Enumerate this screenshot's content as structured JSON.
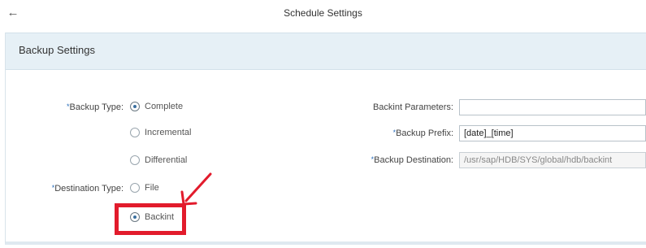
{
  "header": {
    "title": "Schedule Settings",
    "back_icon": "arrow-left-icon"
  },
  "panel": {
    "title": "Backup Settings"
  },
  "backup_type": {
    "label": "Backup Type:",
    "options": [
      {
        "label": "Complete",
        "selected": true
      },
      {
        "label": "Incremental",
        "selected": false
      },
      {
        "label": "Differential",
        "selected": false
      }
    ]
  },
  "destination_type": {
    "label": "Destination Type:",
    "options": [
      {
        "label": "File",
        "selected": false
      },
      {
        "label": "Backint",
        "selected": true
      }
    ]
  },
  "backint_parameters": {
    "label": "Backint Parameters:",
    "value": ""
  },
  "backup_prefix": {
    "label": "Backup Prefix:",
    "value": "[date]_[time]"
  },
  "backup_destination": {
    "label": "Backup Destination:",
    "value": "/usr/sap/HDB/SYS/global/hdb/backint"
  },
  "required_marker": "*",
  "colors": {
    "header_bg": "#e6f0f6",
    "highlight": "#e21b2c",
    "accent": "#3a6f9f"
  }
}
